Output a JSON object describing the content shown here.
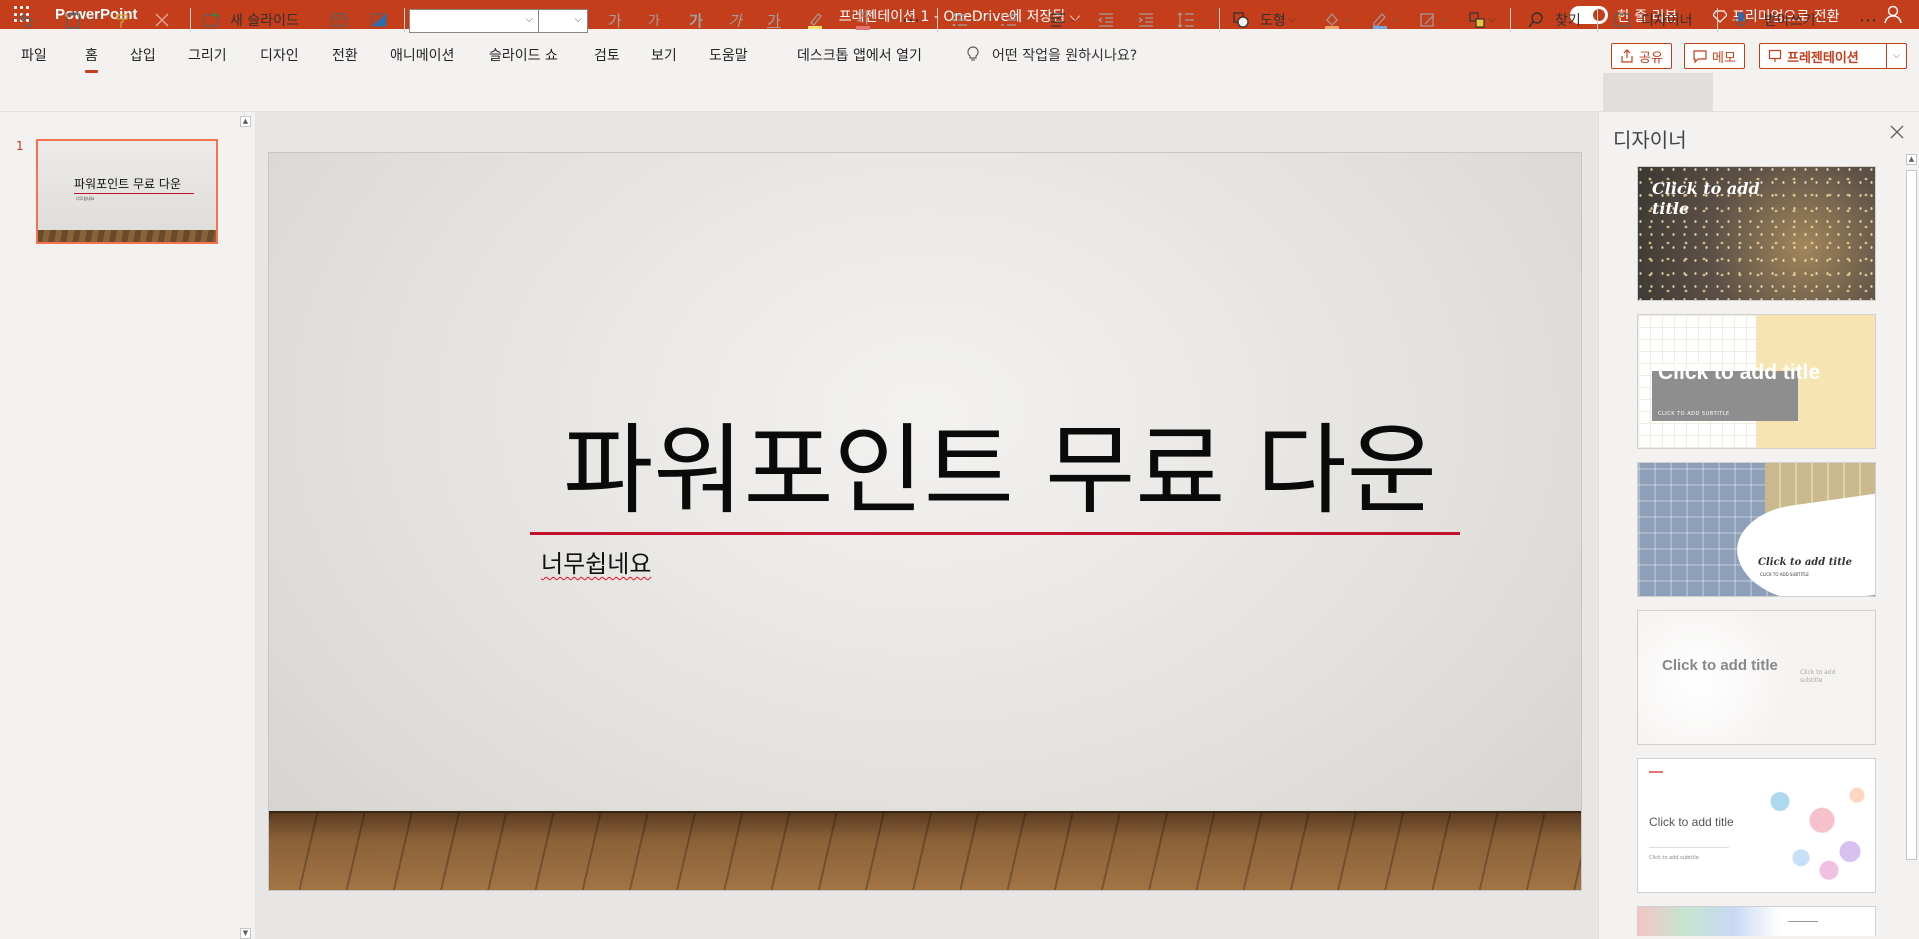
{
  "app": {
    "name": "PowerPoint",
    "document_title": "프레젠테이션 1 - OneDrive에 저장됨 ⌵",
    "simplified_ribbon_label": "한 줄 리본",
    "premium_label": "프리미엄으로 전환"
  },
  "menu": {
    "tabs": [
      {
        "label": "파일"
      },
      {
        "label": "홈"
      },
      {
        "label": "삽입"
      },
      {
        "label": "그리기"
      },
      {
        "label": "디자인"
      },
      {
        "label": "전환"
      },
      {
        "label": "애니메이션"
      },
      {
        "label": "슬라이드 쇼"
      },
      {
        "label": "검토"
      },
      {
        "label": "보기"
      },
      {
        "label": "도움말"
      }
    ],
    "active_tab": "홈",
    "open_desktop": "데스크톱 앱에서 열기",
    "tell_me": "어떤 작업을 원하시나요?",
    "share": "공유",
    "comments": "메모",
    "present": "프레젠테이션"
  },
  "ribbon": {
    "new_slide": "새 슬라이드",
    "font_grow": "가",
    "font_shrink": "가",
    "bold": "가",
    "italic": "가",
    "underline": "가",
    "font_color": "가",
    "shapes": "도형",
    "find": "찾기",
    "designer": "디자이너",
    "dictate": "받아쓰기",
    "more": "⋯"
  },
  "thumbnails": [
    {
      "number": "1",
      "title": "파워포인트 무료 다운",
      "subtitle": "너무쉽네요"
    }
  ],
  "slide": {
    "title": "파워포인트 무료 다운",
    "subtitle": "너무쉽네요",
    "accent_color": "#c4102f"
  },
  "designer": {
    "title": "디자이너",
    "cards": [
      {
        "title": "Click to add title",
        "subtitle": ""
      },
      {
        "title": "Click to add title",
        "subtitle": "CLICK TO ADD SUBTITLE"
      },
      {
        "title": "Click to add title",
        "subtitle": "CLICK TO ADD SUBTITLE"
      },
      {
        "title": "Click to add title",
        "subtitle": "Click to add subtitle"
      },
      {
        "title": "Click to add title",
        "subtitle": "Click to add subtitle"
      }
    ]
  },
  "colors": {
    "brand": "#c43e1c",
    "selection": "#f4724c"
  }
}
